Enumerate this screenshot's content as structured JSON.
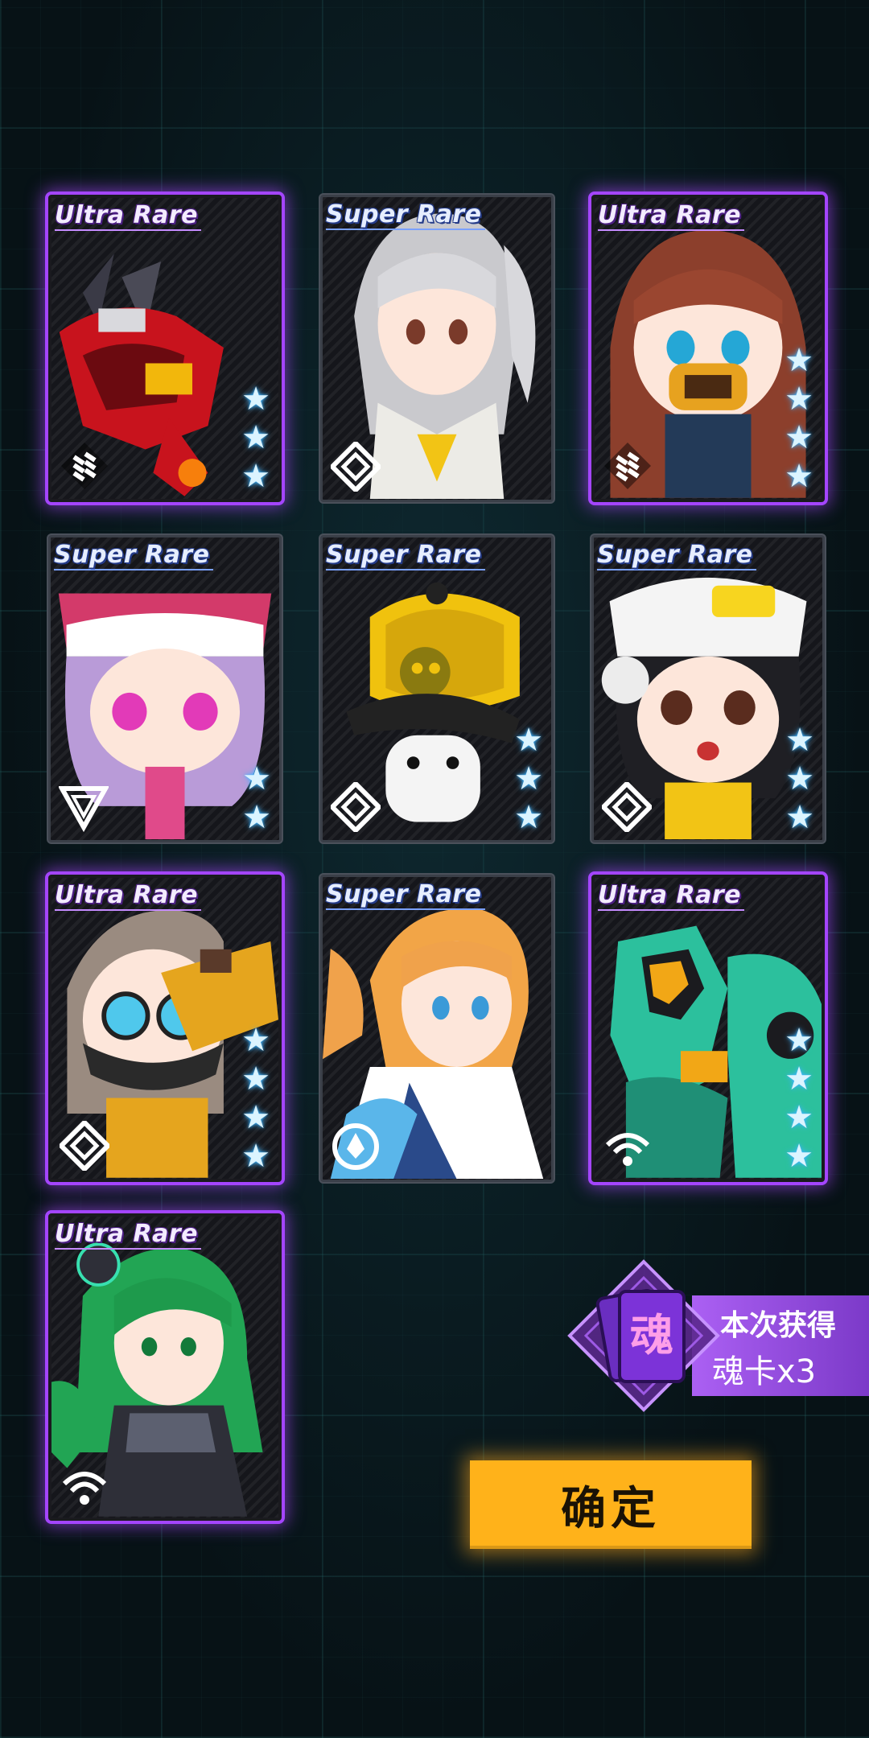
{
  "cards": [
    {
      "rarity": "Ultra Rare",
      "tier": "ur",
      "stars": 3,
      "faction": "bars",
      "art": "red-mech"
    },
    {
      "rarity": "Super Rare",
      "tier": "sr",
      "stars": 0,
      "faction": "diamond",
      "art": "silver-girl"
    },
    {
      "rarity": "Ultra Rare",
      "tier": "ur",
      "stars": 4,
      "faction": "bars",
      "art": "masked-girl"
    },
    {
      "rarity": "Super Rare",
      "tier": "sr",
      "stars": 2,
      "faction": "triangle",
      "art": "purple-girl"
    },
    {
      "rarity": "Super Rare",
      "tier": "sr",
      "stars": 3,
      "faction": "diamond",
      "art": "yellow-mushroom"
    },
    {
      "rarity": "Super Rare",
      "tier": "sr",
      "stars": 3,
      "faction": "diamond",
      "art": "chef-girl"
    },
    {
      "rarity": "Ultra Rare",
      "tier": "ur",
      "stars": 4,
      "faction": "diamond",
      "art": "goggle-girl"
    },
    {
      "rarity": "Super Rare",
      "tier": "sr",
      "stars": 0,
      "faction": "circle",
      "art": "blonde-girl"
    },
    {
      "rarity": "Ultra Rare",
      "tier": "ur",
      "stars": 4,
      "faction": "wifi",
      "art": "green-mech"
    },
    {
      "rarity": "Ultra Rare",
      "tier": "ur",
      "stars": 0,
      "faction": "wifi",
      "art": "green-hair-girl"
    }
  ],
  "reward": {
    "icon_char": "魂",
    "title": "本次获得",
    "count": "魂卡x3"
  },
  "confirm_label": "确定",
  "colors": {
    "ultra_glow": "#a445ff",
    "button": "#ffb21a",
    "star": "#3fb4ff"
  }
}
